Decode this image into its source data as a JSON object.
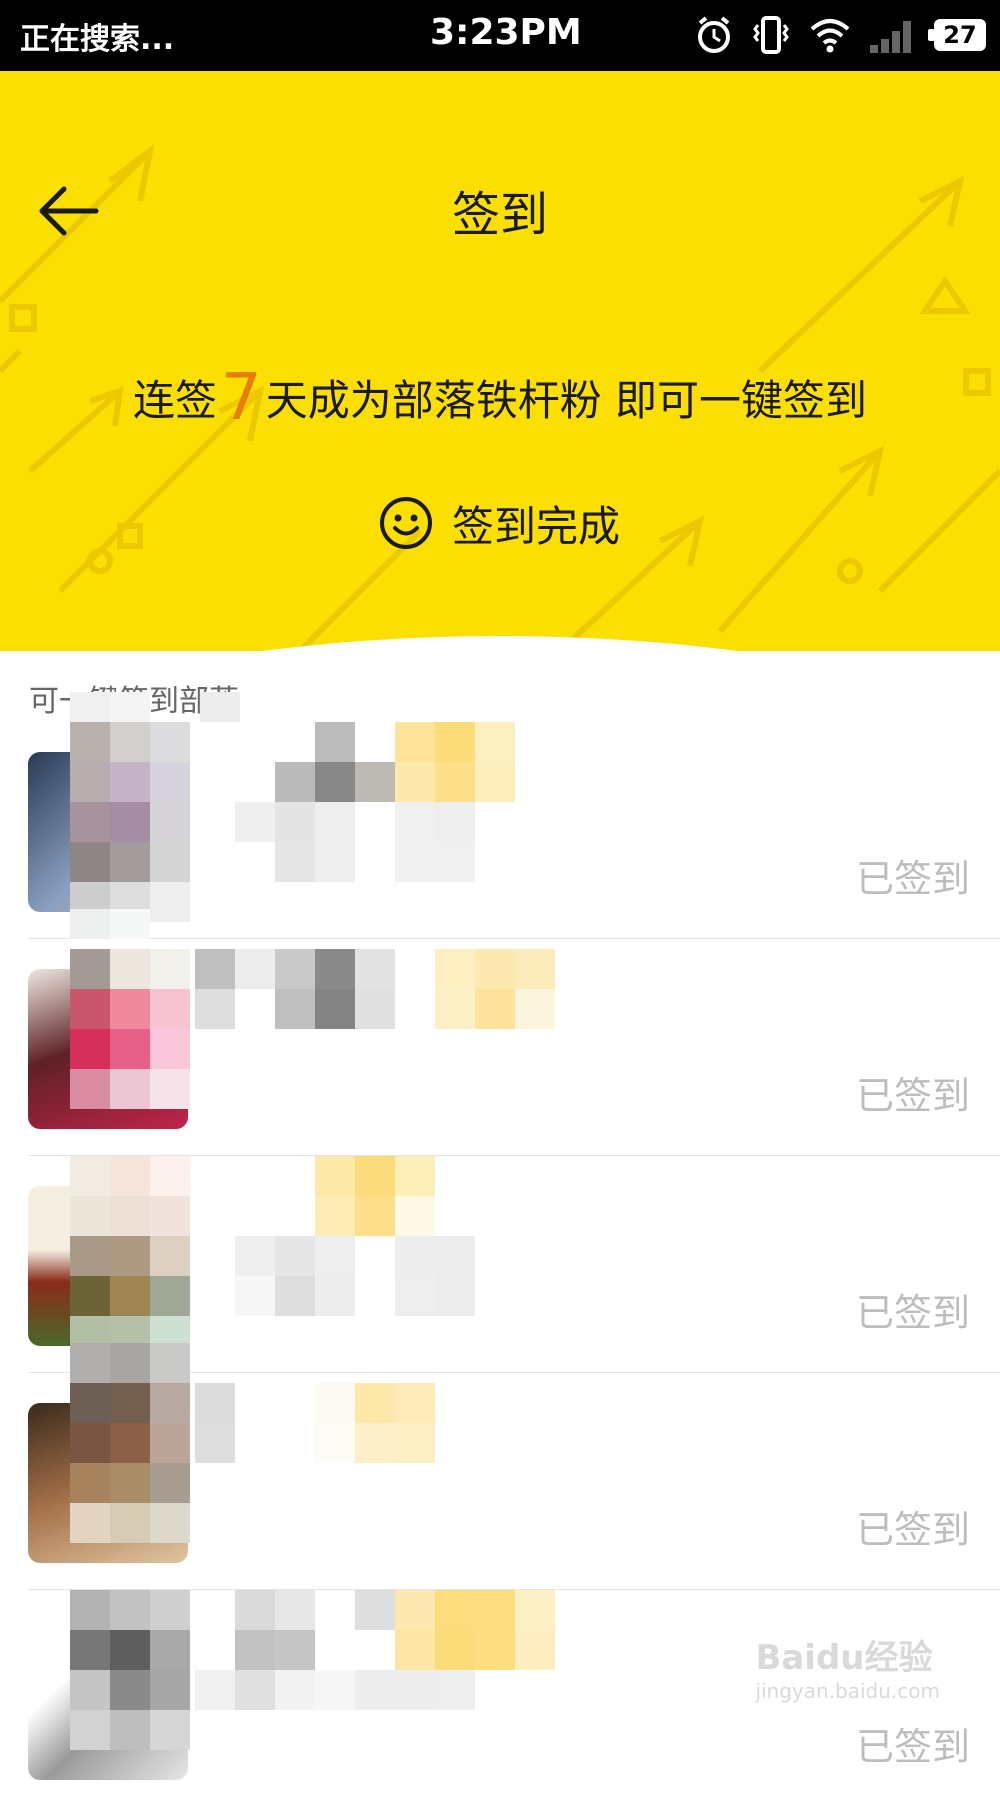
{
  "status_bar": {
    "app_text": "正在搜索...",
    "time": "3:23PM",
    "battery": "27"
  },
  "header": {
    "title": "签到",
    "promo_prefix": "连签",
    "promo_days": "7",
    "promo_suffix": "天成为部落铁杆粉 即可一键签到",
    "done_label": "签到完成"
  },
  "section_label": "可一键签到部落",
  "tribes": [
    {
      "status": "已签到"
    },
    {
      "status": "已签到"
    },
    {
      "status": "已签到"
    },
    {
      "status": "已签到"
    },
    {
      "status": "已签到"
    }
  ],
  "watermark": {
    "brand": "Baidu经验",
    "url": "jingyan.baidu.com"
  },
  "colors": {
    "header_yellow": "#fbdf00",
    "accent_orange": "#e87d00",
    "status_gray": "#bdbdbd"
  }
}
